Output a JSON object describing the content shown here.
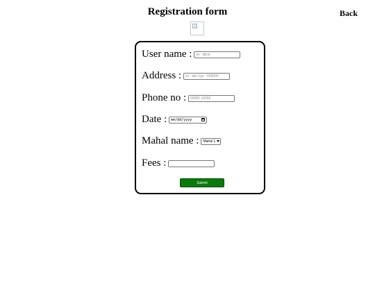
{
  "header": {
    "title": "Registration form",
    "back_label": "Back"
  },
  "form": {
    "username": {
      "label": "User name :",
      "placeholder": "xx : abcd",
      "value": ""
    },
    "address": {
      "label": "Address :",
      "placeholder": "xx - abc,xyz - 000000",
      "value": ""
    },
    "phone": {
      "label": "Phone no :",
      "placeholder": "00001 10000",
      "value": ""
    },
    "date": {
      "label": "Date :",
      "placeholder": "mm/dd/yyyy"
    },
    "mahal": {
      "label": "Mahal name :",
      "selected": "Mahal 1"
    },
    "fees": {
      "label": "Fees :",
      "placeholder": "",
      "value": ""
    },
    "submit_label": "Submit"
  },
  "colors": {
    "submit_bg": "#0a7a0a",
    "card_border": "#000000"
  }
}
